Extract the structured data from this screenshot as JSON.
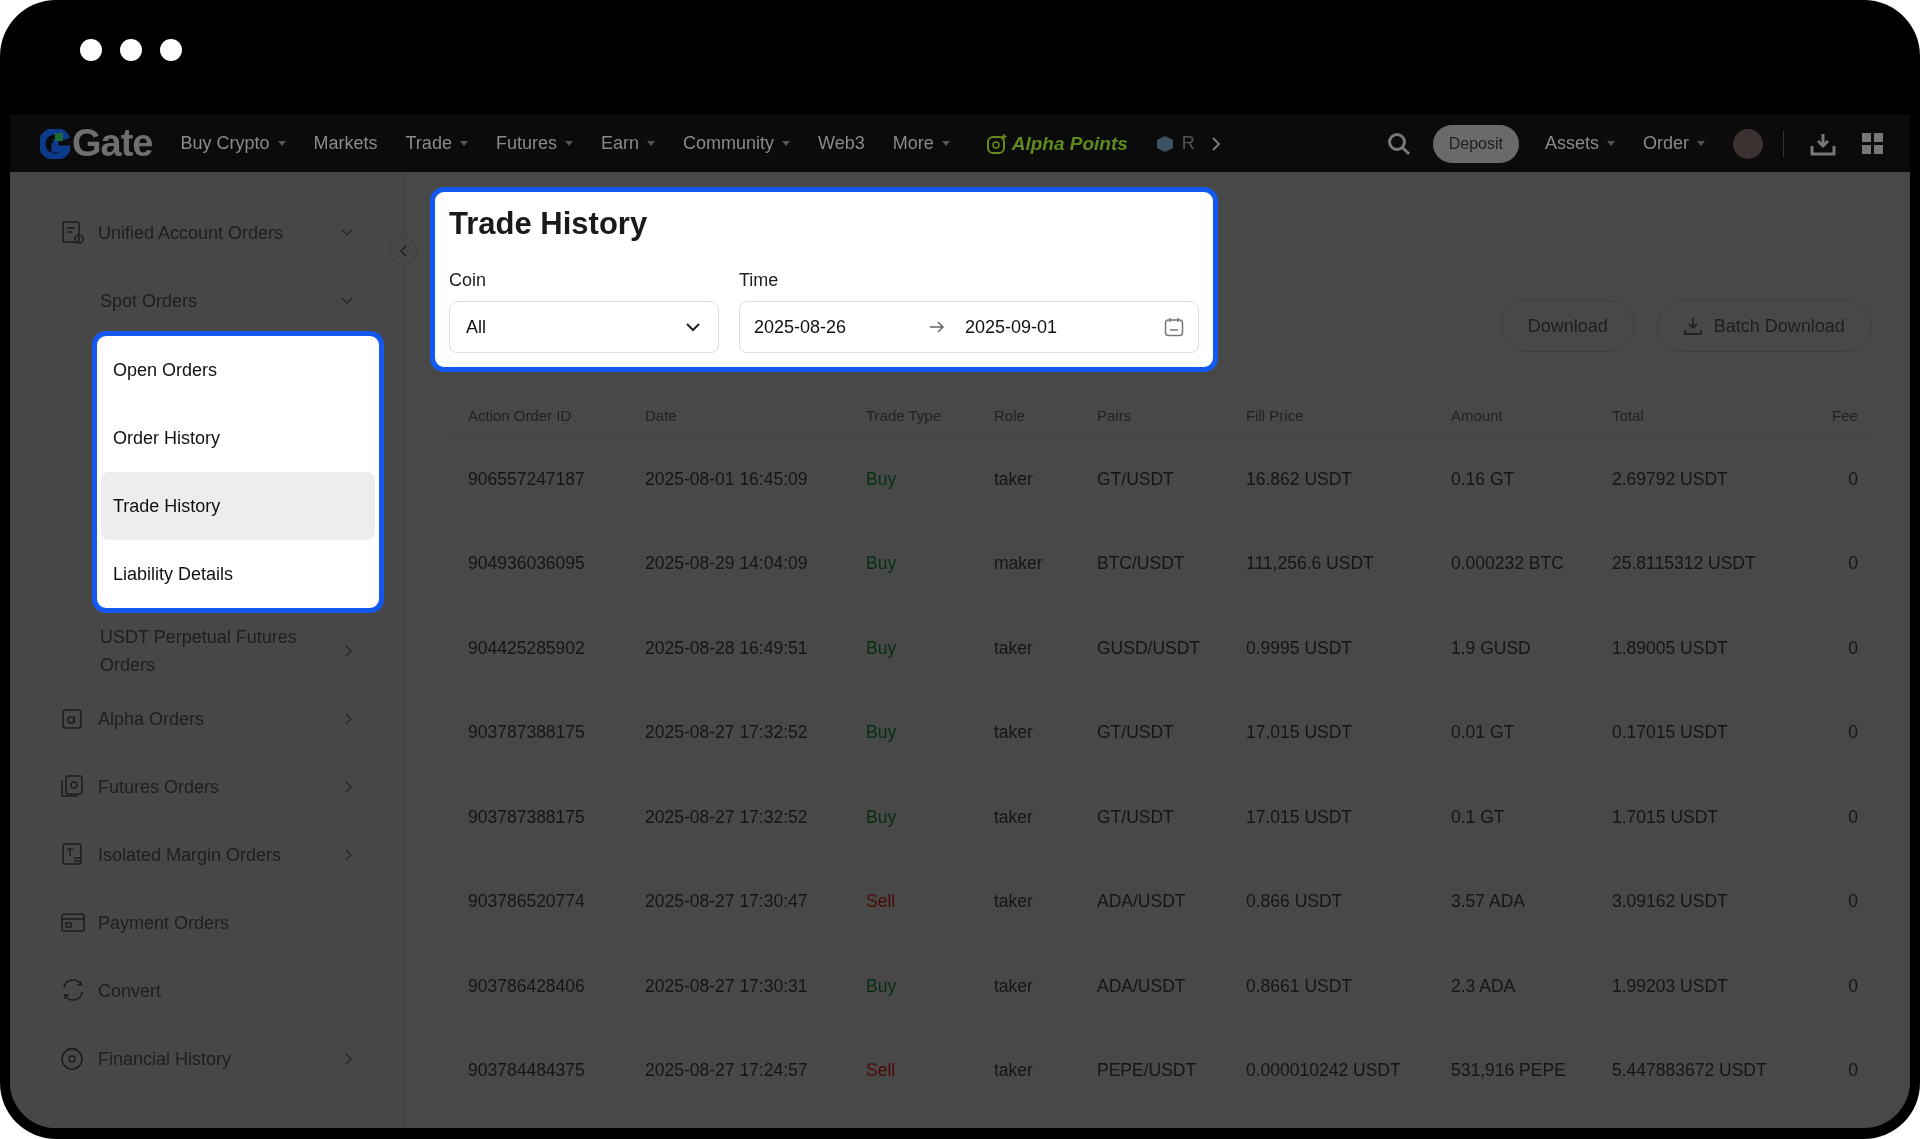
{
  "nav": {
    "logo": "Gate",
    "items": [
      {
        "label": "Buy Crypto",
        "dropdown": true
      },
      {
        "label": "Markets",
        "dropdown": false
      },
      {
        "label": "Trade",
        "dropdown": true
      },
      {
        "label": "Futures",
        "dropdown": true
      },
      {
        "label": "Earn",
        "dropdown": true
      },
      {
        "label": "Community",
        "dropdown": true
      },
      {
        "label": "Web3",
        "dropdown": false
      },
      {
        "label": "More",
        "dropdown": true
      }
    ],
    "promo": "Alpha Points",
    "next_item": "R",
    "deposit": "Deposit",
    "right_items": [
      {
        "label": "Assets",
        "dropdown": true
      },
      {
        "label": "Order",
        "dropdown": true
      }
    ]
  },
  "sidebar": {
    "items": [
      {
        "label": "Unified Account Orders",
        "kind": "folder",
        "expanded": true,
        "children": [
          {
            "label": "Spot Orders",
            "expanded": true,
            "highlighted": true,
            "children": [
              {
                "label": "Open Orders",
                "selected": false
              },
              {
                "label": "Order History",
                "selected": false
              },
              {
                "label": "Trade History",
                "selected": true
              },
              {
                "label": "Liability Details",
                "selected": false
              }
            ]
          },
          {
            "label": "USDT Perpetual Futures Orders",
            "expanded": false
          }
        ]
      },
      {
        "label": "Alpha Orders",
        "kind": "folder",
        "expanded": false
      },
      {
        "label": "Futures Orders",
        "kind": "folder",
        "expanded": false
      },
      {
        "label": "Isolated Margin Orders",
        "kind": "folder",
        "expanded": false
      },
      {
        "label": "Payment Orders",
        "kind": "link"
      },
      {
        "label": "Convert",
        "kind": "link"
      },
      {
        "label": "Financial History",
        "kind": "folder",
        "expanded": false
      }
    ]
  },
  "filter_panel": {
    "title": "Trade History",
    "highlighted": true,
    "coin_label": "Coin",
    "coin_value": "All",
    "time_label": "Time",
    "time_from": "2025-08-26",
    "time_to": "2025-09-01"
  },
  "buttons": [
    "Download",
    "Batch Download"
  ],
  "table": {
    "columns": [
      "Action Order ID",
      "Date",
      "Trade Type",
      "Role",
      "Pairs",
      "Fill Price",
      "Amount",
      "Total",
      "Fee"
    ],
    "rows": [
      {
        "kind": "buy",
        "cells": [
          "906557247187",
          "2025-08-01 16:45:09",
          "Buy",
          "taker",
          "GT/USDT",
          "16.862 USDT",
          "0.16 GT",
          "2.69792 USDT",
          "0"
        ]
      },
      {
        "kind": "buy",
        "cells": [
          "904936036095",
          "2025-08-29 14:04:09",
          "Buy",
          "maker",
          "BTC/USDT",
          "111,256.6 USDT",
          "0.000232 BTC",
          "25.8115312 USDT",
          "0"
        ]
      },
      {
        "kind": "buy",
        "cells": [
          "904425285902",
          "2025-08-28 16:49:51",
          "Buy",
          "taker",
          "GUSD/USDT",
          "0.9995 USDT",
          "1.9 GUSD",
          "1.89005 USDT",
          "0"
        ]
      },
      {
        "kind": "buy",
        "cells": [
          "903787388175",
          "2025-08-27 17:32:52",
          "Buy",
          "taker",
          "GT/USDT",
          "17.015 USDT",
          "0.01 GT",
          "0.17015 USDT",
          "0"
        ]
      },
      {
        "kind": "buy",
        "cells": [
          "903787388175",
          "2025-08-27 17:32:52",
          "Buy",
          "taker",
          "GT/USDT",
          "17.015 USDT",
          "0.1 GT",
          "1.7015 USDT",
          "0"
        ]
      },
      {
        "kind": "sell",
        "cells": [
          "903786520774",
          "2025-08-27 17:30:47",
          "Sell",
          "taker",
          "ADA/USDT",
          "0.866 USDT",
          "3.57 ADA",
          "3.09162 USDT",
          "0"
        ]
      },
      {
        "kind": "buy",
        "cells": [
          "903786428406",
          "2025-08-27 17:30:31",
          "Buy",
          "taker",
          "ADA/USDT",
          "0.8661 USDT",
          "2.3 ADA",
          "1.99203 USDT",
          "0"
        ]
      },
      {
        "kind": "sell",
        "cells": [
          "903784484375",
          "2025-08-27 17:24:57",
          "Sell",
          "taker",
          "PEPE/USDT",
          "0.000010242 USDT",
          "531,916 PEPE",
          "5.447883672 USDT",
          "0"
        ]
      }
    ]
  }
}
